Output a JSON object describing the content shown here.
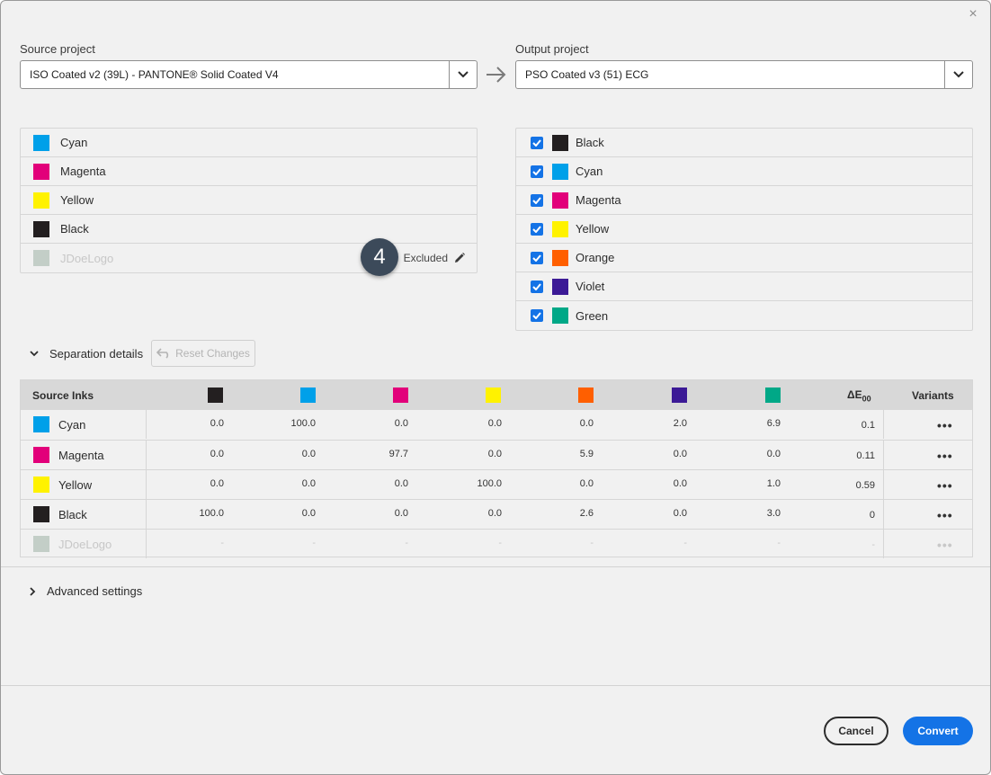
{
  "dialog": {
    "close_label": "×"
  },
  "source": {
    "label": "Source project",
    "value": "ISO Coated v2 (39L) - PANTONE® Solid Coated V4",
    "inks": [
      {
        "name": "Cyan",
        "color": "#00a0e9"
      },
      {
        "name": "Magenta",
        "color": "#e2007a"
      },
      {
        "name": "Yellow",
        "color": "#fff200"
      },
      {
        "name": "Black",
        "color": "#231f20"
      },
      {
        "name": "JDoeLogo",
        "color": "#c3cec7",
        "disabled": true,
        "status": "Excluded"
      }
    ]
  },
  "output": {
    "label": "Output project",
    "value": "PSO Coated v3 (51) ECG",
    "inks": [
      {
        "name": "Black",
        "color": "#231f20",
        "checked": true
      },
      {
        "name": "Cyan",
        "color": "#00a0e9",
        "checked": true
      },
      {
        "name": "Magenta",
        "color": "#e2007a",
        "checked": true
      },
      {
        "name": "Yellow",
        "color": "#fff200",
        "checked": true
      },
      {
        "name": "Orange",
        "color": "#ff5f00",
        "checked": true
      },
      {
        "name": "Violet",
        "color": "#3c1a96",
        "checked": true
      },
      {
        "name": "Green",
        "color": "#00a887",
        "checked": true
      }
    ]
  },
  "badge": {
    "number": "4"
  },
  "separation": {
    "toggle_label": "Separation details",
    "reset_label": "Reset Changes",
    "table": {
      "col_source": "Source Inks",
      "col_de": "ΔE",
      "col_de_sub": "00",
      "col_variants": "Variants",
      "header_swatches": [
        "#231f20",
        "#00a0e9",
        "#e2007a",
        "#fff200",
        "#ff5f00",
        "#3c1a96",
        "#00a887"
      ],
      "rows": [
        {
          "name": "Cyan",
          "color": "#00a0e9",
          "values": [
            "0.0",
            "100.0",
            "0.0",
            "0.0",
            "0.0",
            "2.0",
            "6.9"
          ],
          "de": "0.1",
          "variants": "•••"
        },
        {
          "name": "Magenta",
          "color": "#e2007a",
          "values": [
            "0.0",
            "0.0",
            "97.7",
            "0.0",
            "5.9",
            "0.0",
            "0.0"
          ],
          "de": "0.11",
          "variants": "•••"
        },
        {
          "name": "Yellow",
          "color": "#fff200",
          "values": [
            "0.0",
            "0.0",
            "0.0",
            "100.0",
            "0.0",
            "0.0",
            "1.0"
          ],
          "de": "0.59",
          "variants": "•••"
        },
        {
          "name": "Black",
          "color": "#231f20",
          "values": [
            "100.0",
            "0.0",
            "0.0",
            "0.0",
            "2.6",
            "0.0",
            "3.0"
          ],
          "de": "0",
          "variants": "•••"
        },
        {
          "name": "JDoeLogo",
          "color": "#c3cec7",
          "disabled": true,
          "values": [
            "-",
            "-",
            "-",
            "-",
            "-",
            "-",
            "-"
          ],
          "de": "-",
          "variants": "•••"
        }
      ]
    }
  },
  "advanced": {
    "toggle_label": "Advanced settings"
  },
  "footer": {
    "cancel_label": "Cancel",
    "convert_label": "Convert"
  }
}
